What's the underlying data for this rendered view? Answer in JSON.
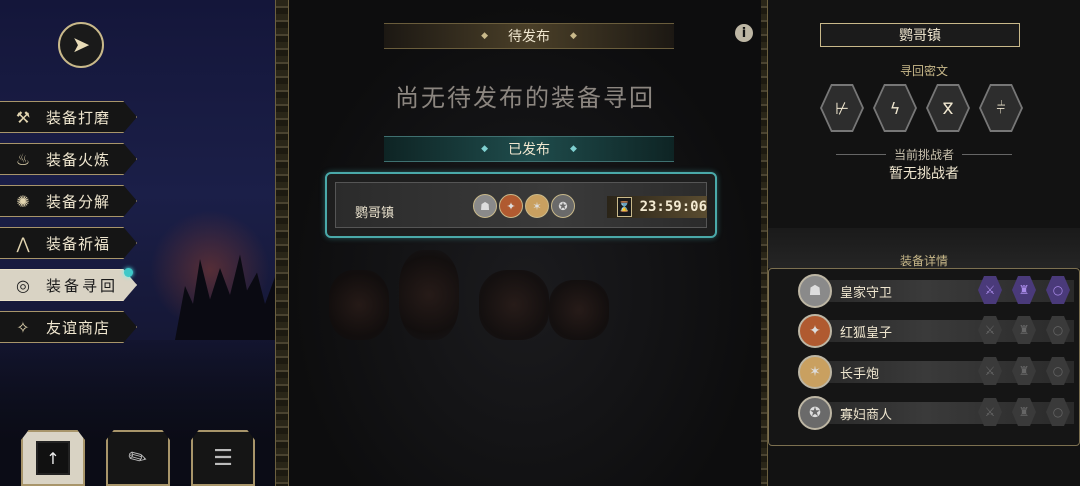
{
  "left_menu": {
    "items": [
      {
        "label": "装备打磨",
        "icon": "hammer-icon",
        "glyph": "⚒"
      },
      {
        "label": "装备火炼",
        "icon": "flame-icon",
        "glyph": "🜂"
      },
      {
        "label": "装备分解",
        "icon": "disassemble-icon",
        "glyph": "✺"
      },
      {
        "label": "装备祈福",
        "icon": "pray-icon",
        "glyph": "⋀"
      },
      {
        "label": "装备寻回",
        "icon": "target-icon",
        "glyph": "◎",
        "active": true
      },
      {
        "label": "友谊商店",
        "icon": "fox-icon",
        "glyph": "✧"
      }
    ],
    "bottom_buttons": [
      "upload-icon",
      "feather-icon",
      "list-icon"
    ]
  },
  "center": {
    "pending_header": "待发布",
    "empty_message": "尚无待发布的装备寻回",
    "published_header": "已发布",
    "bounty": {
      "town": "鹦哥镇",
      "timer": "23:59:06",
      "avatars": [
        "royal-guard-avatar",
        "red-fox-avatar",
        "long-gun-avatar",
        "widow-merchant-avatar"
      ]
    }
  },
  "right": {
    "town_title": "鹦哥镇",
    "cipher_label": "寻回密文",
    "ciphers": [
      "⊬",
      "ϟ",
      "ⴳ",
      "⫩"
    ],
    "challenger_label": "当前挑战者",
    "challenger_value": "暂无挑战者",
    "detail_label": "装备详情",
    "heroes": [
      {
        "name": "皇家守卫",
        "slots": [
          true,
          true,
          true
        ]
      },
      {
        "name": "红狐皇子",
        "slots": [
          false,
          false,
          false
        ]
      },
      {
        "name": "长手炮",
        "slots": [
          false,
          false,
          false
        ]
      },
      {
        "name": "寡妇商人",
        "slots": [
          false,
          false,
          false
        ]
      }
    ]
  },
  "colors": {
    "gold": "#c9b98a",
    "teal": "#4aa9a9",
    "equip_active": "#4a3a7a"
  }
}
